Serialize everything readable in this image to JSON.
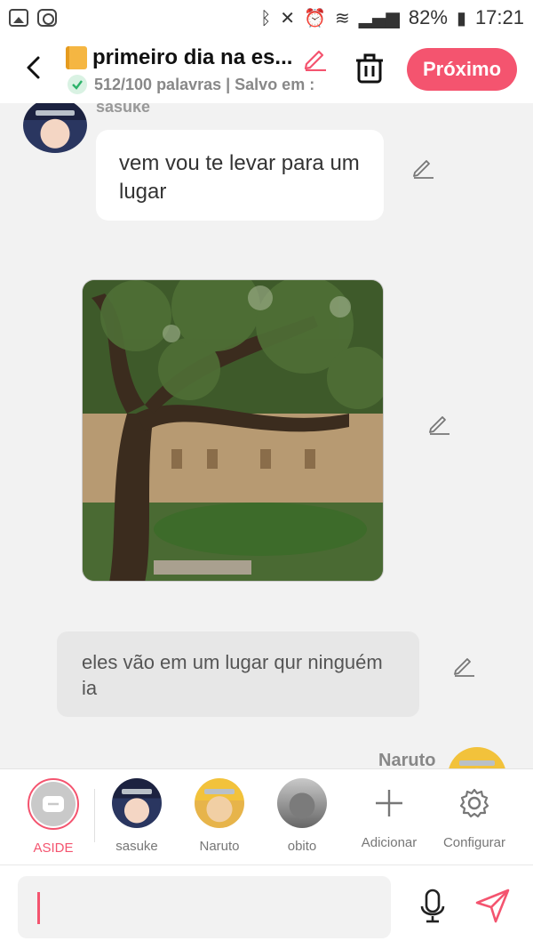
{
  "status_bar": {
    "battery_percent": "82%",
    "time": "17:21"
  },
  "header": {
    "title": "primeiro dia na es...",
    "subtitle": "512/100 palavras | Salvo em :",
    "next_label": "Próximo"
  },
  "chat": {
    "messages": [
      {
        "speaker": "sasuke",
        "text": "vem vou te levar para um lugar"
      },
      {
        "type": "image",
        "alt": "tree-courtyard-photo"
      },
      {
        "speaker": "aside",
        "text": "eles vão em um lugar qur ninguém ia"
      },
      {
        "speaker": "Naruto",
        "text": ""
      }
    ]
  },
  "characters": [
    {
      "label": "ASIDE"
    },
    {
      "label": "sasuke"
    },
    {
      "label": "Naruto"
    },
    {
      "label": "obito"
    },
    {
      "label": "Adicionar"
    },
    {
      "label": "Configurar"
    }
  ],
  "input": {
    "value": ""
  },
  "colors": {
    "accent": "#f4546f"
  },
  "icons": [
    "back-icon",
    "pencil-icon",
    "trash-icon",
    "check-icon",
    "microphone-icon",
    "send-icon",
    "plus-icon",
    "gear-icon"
  ]
}
